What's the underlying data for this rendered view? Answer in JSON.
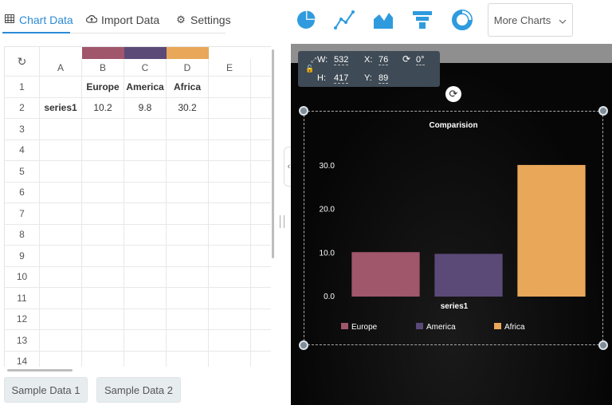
{
  "tabs": {
    "chart_data": "Chart Data",
    "import_data": "Import Data",
    "settings": "Settings"
  },
  "grid": {
    "corner_icon": "refresh-icon",
    "columns": [
      "A",
      "B",
      "C",
      "D",
      "E"
    ],
    "column_colors": {
      "B": "#a0566b",
      "C": "#5b4a78",
      "D": "#e9a75a"
    },
    "rows": [
      {
        "num": "1",
        "cells": [
          "",
          "Europe",
          "America",
          "Africa",
          ""
        ]
      },
      {
        "num": "2",
        "cells": [
          "series1",
          "10.2",
          "9.8",
          "30.2",
          ""
        ]
      },
      {
        "num": "3",
        "cells": [
          "",
          "",
          "",
          "",
          ""
        ]
      },
      {
        "num": "4",
        "cells": [
          "",
          "",
          "",
          "",
          ""
        ]
      },
      {
        "num": "5",
        "cells": [
          "",
          "",
          "",
          "",
          ""
        ]
      },
      {
        "num": "6",
        "cells": [
          "",
          "",
          "",
          "",
          ""
        ]
      },
      {
        "num": "7",
        "cells": [
          "",
          "",
          "",
          "",
          ""
        ]
      },
      {
        "num": "8",
        "cells": [
          "",
          "",
          "",
          "",
          ""
        ]
      },
      {
        "num": "9",
        "cells": [
          "",
          "",
          "",
          "",
          ""
        ]
      },
      {
        "num": "10",
        "cells": [
          "",
          "",
          "",
          "",
          ""
        ]
      },
      {
        "num": "11",
        "cells": [
          "",
          "",
          "",
          "",
          ""
        ]
      },
      {
        "num": "12",
        "cells": [
          "",
          "",
          "",
          "",
          ""
        ]
      },
      {
        "num": "13",
        "cells": [
          "",
          "",
          "",
          "",
          ""
        ]
      },
      {
        "num": "14",
        "cells": [
          "",
          "",
          "",
          "",
          ""
        ]
      }
    ]
  },
  "buttons": {
    "sample1": "Sample Data 1",
    "sample2": "Sample Data 2"
  },
  "toolbar": {
    "more_charts": "More Charts"
  },
  "dims": {
    "w_label": "W:",
    "w_val": "532",
    "x_label": "X:",
    "x_val": "76",
    "r_val": "0°",
    "h_label": "H:",
    "h_val": "417",
    "y_label": "Y:",
    "y_val": "89"
  },
  "colors": {
    "accent": "#2c8bd6",
    "icon_blue": "#2f9bde"
  },
  "chart_data": {
    "type": "bar",
    "title": "Comparision",
    "categories": [
      "series1"
    ],
    "xlabel": "series1",
    "ylim": [
      0,
      30
    ],
    "yticks": [
      "0.0",
      "10.0",
      "20.0",
      "30.0"
    ],
    "series": [
      {
        "name": "Europe",
        "values": [
          10.2
        ],
        "color": "#a0566b"
      },
      {
        "name": "America",
        "values": [
          9.8
        ],
        "color": "#5b4a78"
      },
      {
        "name": "Africa",
        "values": [
          30.2
        ],
        "color": "#e9a75a"
      }
    ],
    "legend": "bottom-left",
    "grid": false
  }
}
